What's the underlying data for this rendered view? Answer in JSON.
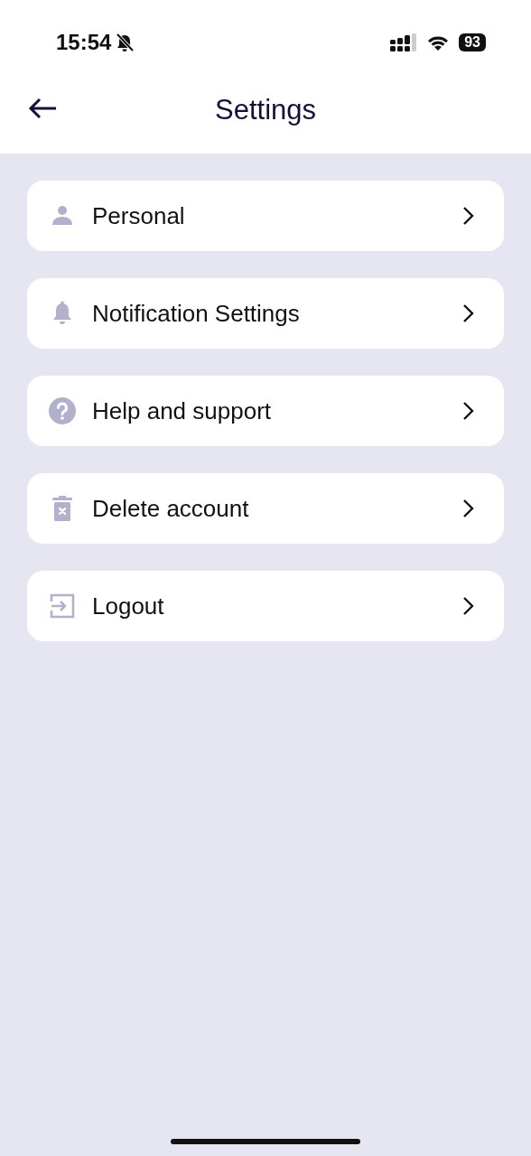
{
  "status_bar": {
    "time": "15:54",
    "battery": "93"
  },
  "header": {
    "title": "Settings"
  },
  "items": [
    {
      "label": "Personal",
      "kind": "person"
    },
    {
      "label": "Notification Settings",
      "kind": "bell"
    },
    {
      "label": "Help and support",
      "kind": "help"
    },
    {
      "label": "Delete account",
      "kind": "trash"
    },
    {
      "label": "Logout",
      "kind": "logout"
    }
  ]
}
